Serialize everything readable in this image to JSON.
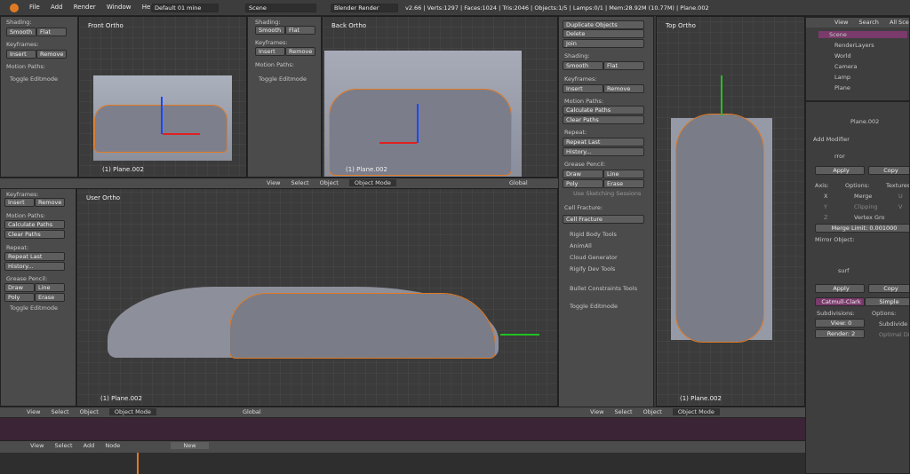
{
  "topbar": {
    "menus": [
      "File",
      "Add",
      "Render",
      "Window",
      "Help"
    ],
    "layout": "Default 01 mine",
    "scene": "Scene",
    "engine": "Blender Render",
    "stats": "v2.66 | Verts:1297 | Faces:1024 | Tris:2046 | Objects:1/5 | Lamps:0/1 | Mem:28.92M (10.77M) | Plane.002"
  },
  "tl": {
    "shading": "Shading:",
    "smooth": "Smooth",
    "flat": "Flat",
    "keyframes": "Keyframes:",
    "insert": "Insert",
    "remove": "Remove",
    "motion": "Motion Paths:",
    "toggle": "Toggle Editmode"
  },
  "t2": {
    "shading": "Shading:",
    "smooth": "Smooth",
    "flat": "Flat",
    "keyframes": "Keyframes:",
    "insert": "Insert",
    "remove": "Remove",
    "motion": "Motion Paths:",
    "toggle": "Toggle Editmode"
  },
  "front": {
    "title": "Front Ortho",
    "obj": "(1) Plane.002"
  },
  "back": {
    "title": "Back Ortho",
    "obj": "(1) Plane.002"
  },
  "user": {
    "title": "User Ortho",
    "obj": "(1) Plane.002"
  },
  "top": {
    "title": "Top Ortho",
    "obj": "(1) Plane.002"
  },
  "left_tools": {
    "keyframes": "Keyframes:",
    "insert": "Insert",
    "remove": "Remove",
    "motion": "Motion Paths:",
    "calc": "Calculate Paths",
    "clear": "Clear Paths",
    "repeat": "Repeat:",
    "repeat_last": "Repeat Last",
    "history": "History...",
    "grease": "Grease Pencil:",
    "draw": "Draw",
    "line": "Line",
    "poly": "Poly",
    "erase": "Erase",
    "toggle": "Toggle Editmode"
  },
  "mid_tools": {
    "dup": "Duplicate Objects",
    "delete": "Delete",
    "join": "Join",
    "shading": "Shading:",
    "smooth": "Smooth",
    "flat": "Flat",
    "keyframes": "Keyframes:",
    "insert": "Insert",
    "remove": "Remove",
    "motion": "Motion Paths:",
    "calc": "Calculate Paths",
    "clear": "Clear Paths",
    "repeat": "Repeat:",
    "repeat_last": "Repeat Last",
    "history": "History...",
    "grease": "Grease Pencil:",
    "draw": "Draw",
    "line": "Line",
    "poly": "Poly",
    "erase": "Erase",
    "sketch": "Use Sketching Sessions",
    "cell": "Cell Fracture:",
    "cell_btn": "Cell Fracture",
    "rigid": "Rigid Body Tools",
    "animall": "AnimAll",
    "cloud": "Cloud Generator",
    "rigify": "Rigify Dev Tools",
    "bullet": "Bullet Constraints Tools",
    "toggle": "Toggle Editmode"
  },
  "hdr": {
    "view": "View",
    "select": "Select",
    "object": "Object",
    "mode": "Object Mode",
    "global": "Global"
  },
  "outliner": {
    "view": "View",
    "search": "Search",
    "all": "All Scenes",
    "items": [
      "Scene",
      "RenderLayers",
      "World",
      "Camera",
      "Lamp",
      "Plane"
    ]
  },
  "props": {
    "obj": "Plane.002",
    "add_mod": "Add Modifier",
    "mirror": "rror",
    "apply": "Apply",
    "copy": "Copy",
    "axis": "Axis:",
    "options": "Options:",
    "textures": "Textures",
    "x": "X",
    "y": "Y",
    "z": "Z",
    "u": "U",
    "v": "V",
    "merge": "Merge",
    "clipping": "Clipping",
    "vertex": "Vertex Gro",
    "merge_limit": "Merge Limit: 0.001000",
    "mirror_obj": "Mirror Object:",
    "surf": "surf",
    "catmull": "Catmull-Clark",
    "simple": "Simple",
    "subdiv": "Subdivisions:",
    "options2": "Options:",
    "view0": "View: 0",
    "render2": "Render: 2",
    "subdiv_uv": "Subdivide U",
    "optimal": "Optimal Dis"
  },
  "timeline": {
    "view": "View",
    "select": "Select",
    "add": "Add",
    "node": "Node",
    "new": "New"
  },
  "colors": {
    "accent": "#e07a24",
    "selection": "#7a3a6b"
  }
}
